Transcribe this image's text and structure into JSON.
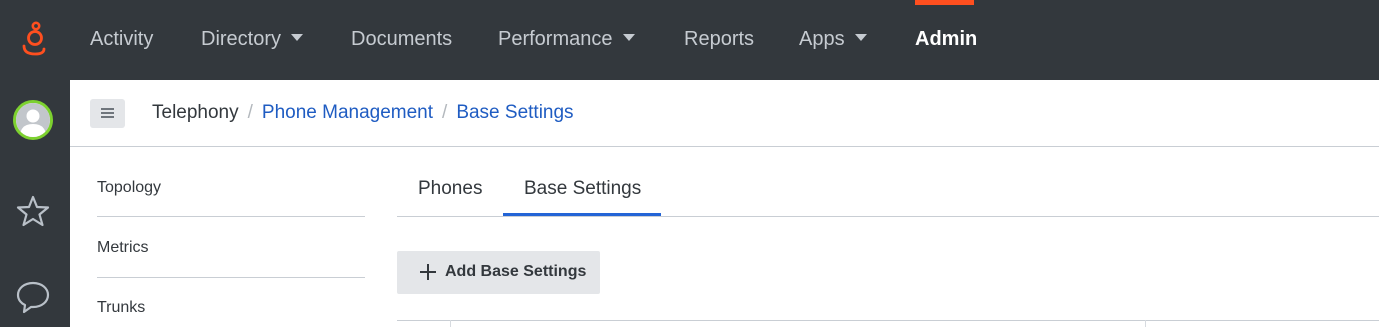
{
  "nav": {
    "items": [
      {
        "label": "Activity",
        "has_dropdown": false
      },
      {
        "label": "Directory",
        "has_dropdown": true
      },
      {
        "label": "Documents",
        "has_dropdown": false
      },
      {
        "label": "Performance",
        "has_dropdown": true
      },
      {
        "label": "Reports",
        "has_dropdown": false
      },
      {
        "label": "Apps",
        "has_dropdown": true
      },
      {
        "label": "Admin",
        "has_dropdown": false,
        "active": true
      }
    ],
    "accent_color": "#ff4f1f",
    "background": "#33383d"
  },
  "rail": {
    "icons": [
      "genesys-logo-icon",
      "user-avatar-icon",
      "star-icon",
      "chat-bubble-icon"
    ],
    "avatar_ring_color": "#7dd12f"
  },
  "breadcrumb": {
    "items": [
      "Telephony",
      "Phone Management",
      "Base Settings"
    ],
    "separator": "/",
    "link_color": "#1f5cc2"
  },
  "sidebar": {
    "items": [
      {
        "label": "Topology"
      },
      {
        "label": "Metrics"
      },
      {
        "label": "Trunks"
      }
    ]
  },
  "tabs": [
    {
      "label": "Phones",
      "active": false
    },
    {
      "label": "Base Settings",
      "active": true
    }
  ],
  "actions": {
    "add_label": "Add Base Settings"
  }
}
